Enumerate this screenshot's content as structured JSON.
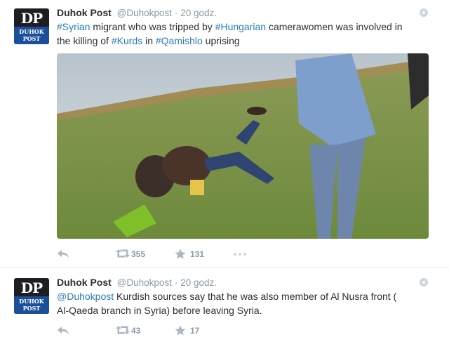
{
  "tweets": [
    {
      "avatar": {
        "monogram": "DP",
        "line1": "DUHOK",
        "line2": "POST"
      },
      "name": "Duhok Post",
      "handle": "@Duhokpost",
      "separator": "·",
      "time": "20 godz.",
      "text1": {
        "tag1": "#Syrian",
        "t1": " migrant who was tripped by ",
        "tag2": "#Hungarian",
        "t2": " camerawomen was involved in"
      },
      "text2": {
        "t3": "the killing of ",
        "tag3": "#Kurds",
        "t4": " in ",
        "tag4": "#Qamishlo",
        "t5": " uprising"
      },
      "actions": {
        "retweet_count": "355",
        "favorite_count": "131"
      }
    },
    {
      "avatar": {
        "monogram": "DP",
        "line1": "DUHOK",
        "line2": "POST"
      },
      "name": "Duhok Post",
      "handle": "@Duhokpost",
      "separator": "·",
      "time": "20 godz.",
      "mention": "@Duhokpost",
      "line1_rest": " Kurdish sources say that he was also member of Al Nusra front  (",
      "line2": "Al-Qaeda branch in Syria) before leaving Syria.",
      "actions": {
        "retweet_count": "43",
        "favorite_count": "17"
      }
    }
  ],
  "icons": [
    "reply-icon",
    "retweet-icon",
    "favorite-icon",
    "more-icon",
    "gear-icon"
  ],
  "colors": {
    "link": "#2b7bb9",
    "muted": "#8899a6",
    "icon": "#aab8c2",
    "avatar_band": "#1c4f9b"
  }
}
